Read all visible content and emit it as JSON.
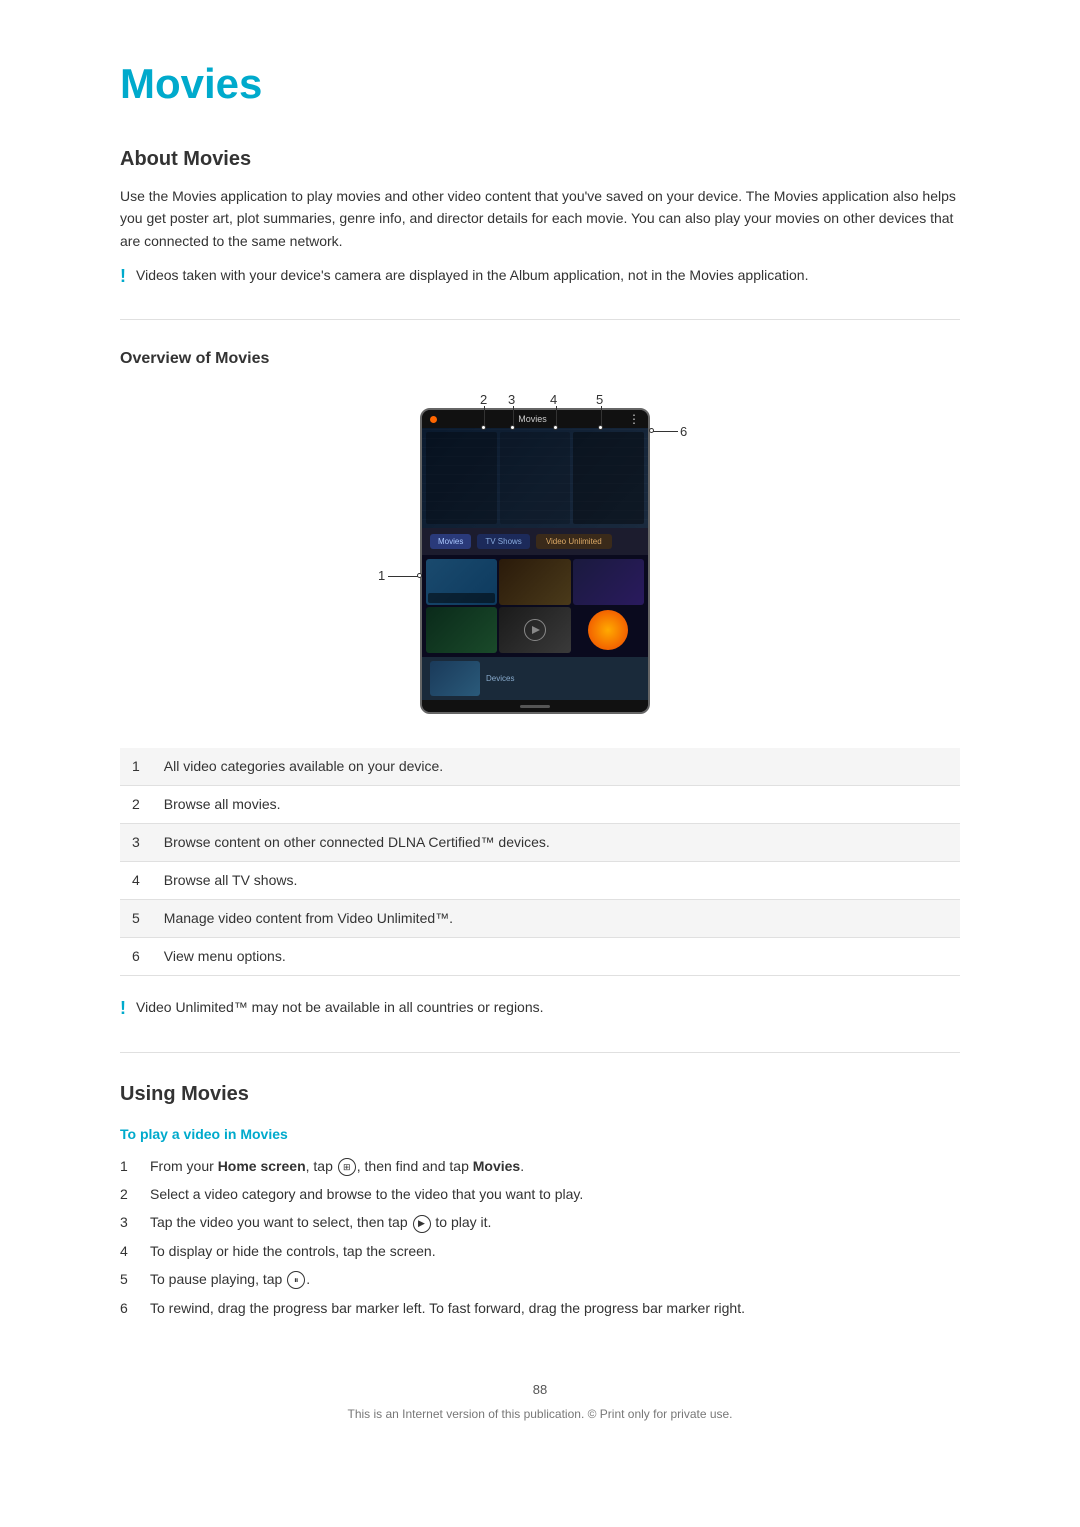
{
  "page": {
    "title": "Movies",
    "page_number": "88",
    "copyright": "This is an Internet version of this publication. © Print only for private use."
  },
  "about_movies": {
    "heading": "About Movies",
    "body": "Use the Movies application to play movies and other video content that you've saved on your device. The Movies application also helps you get poster art, plot summaries, genre info, and director details for each movie. You can also play your movies on other devices that are connected to the same network.",
    "note": "Videos taken with your device's camera are displayed in the Album application, not in the Movies application."
  },
  "overview": {
    "heading": "Overview of Movies",
    "callouts": [
      {
        "number": "1",
        "label": "1"
      },
      {
        "number": "2",
        "label": "2"
      },
      {
        "number": "3",
        "label": "3"
      },
      {
        "number": "4",
        "label": "4"
      },
      {
        "number": "5",
        "label": "5"
      },
      {
        "number": "6",
        "label": "6"
      }
    ],
    "table": [
      {
        "num": "1",
        "desc": "All video categories available on your device."
      },
      {
        "num": "2",
        "desc": "Browse all movies."
      },
      {
        "num": "3",
        "desc": "Browse content on other connected DLNA Certified™ devices."
      },
      {
        "num": "4",
        "desc": "Browse all TV shows."
      },
      {
        "num": "5",
        "desc": "Manage video content from Video Unlimited™."
      },
      {
        "num": "6",
        "desc": "View menu options."
      }
    ],
    "note": "Video Unlimited™ may not be available in all countries or regions."
  },
  "using_movies": {
    "heading": "Using Movies",
    "procedure_title": "To play a video in Movies",
    "steps": [
      {
        "num": "1",
        "text_before": "From your ",
        "bold_1": "Home screen",
        "text_mid": ", tap ",
        "icon": "grid",
        "text_after": ", then find and tap ",
        "bold_2": "Movies",
        "text_end": "."
      },
      {
        "num": "2",
        "text": "Select a video category and browse to the video that you want to play."
      },
      {
        "num": "3",
        "text_before": "Tap the video you want to select, then tap ",
        "icon": "play",
        "text_after": " to play it."
      },
      {
        "num": "4",
        "text": "To display or hide the controls, tap the screen."
      },
      {
        "num": "5",
        "text_before": "To pause playing, tap ",
        "icon": "pause",
        "text_after": "."
      },
      {
        "num": "6",
        "text": "To rewind, drag the progress bar marker left. To fast forward, drag the progress bar marker right."
      }
    ]
  }
}
